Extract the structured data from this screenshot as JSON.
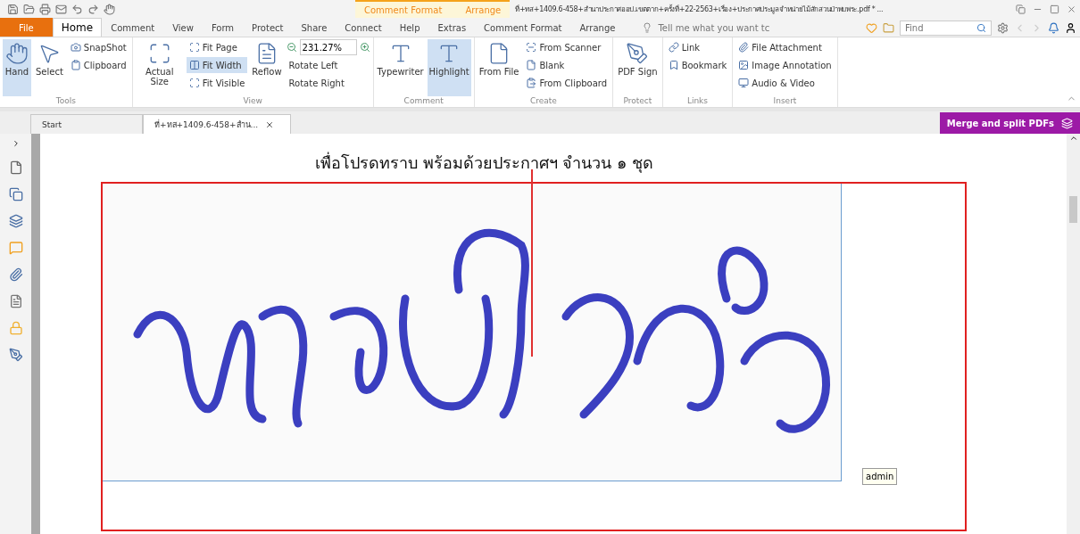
{
  "window": {
    "title": "ที่+ทส+1409.6-458+สำนาประกาศออป.เขตตาก+ครั้งที่+22-2563+เรื่อง+ประกาศประมูลจำหน่ายไม้สักสวนป่าพบพระ.pdf * ..."
  },
  "context_tabs": [
    "Comment Format",
    "Arrange"
  ],
  "tabs": [
    {
      "label": "File",
      "kind": "file",
      "selected": false
    },
    {
      "label": "Home",
      "kind": "tab",
      "selected": true
    },
    {
      "label": "Comment",
      "kind": "tab",
      "selected": false
    },
    {
      "label": "View",
      "kind": "tab",
      "selected": false
    },
    {
      "label": "Form",
      "kind": "tab",
      "selected": false
    },
    {
      "label": "Protect",
      "kind": "tab",
      "selected": false
    },
    {
      "label": "Share",
      "kind": "tab",
      "selected": false
    },
    {
      "label": "Connect",
      "kind": "tab",
      "selected": false
    },
    {
      "label": "Help",
      "kind": "tab",
      "selected": false
    },
    {
      "label": "Extras",
      "kind": "tab",
      "selected": false
    },
    {
      "label": "Comment Format",
      "kind": "tab",
      "selected": false
    },
    {
      "label": "Arrange",
      "kind": "tab",
      "selected": false
    }
  ],
  "tell_me": {
    "placeholder": "Tell me what you want tc"
  },
  "find": {
    "placeholder": "Find"
  },
  "ribbon": [
    {
      "label": "Tools",
      "columns": [
        [
          {
            "kind": "large",
            "label": "Hand",
            "selected": true
          }
        ],
        [
          {
            "kind": "large",
            "label": "Select",
            "selected": false
          }
        ],
        [
          {
            "kind": "small",
            "label": "SnapShot",
            "selected": false
          },
          {
            "kind": "small",
            "label": "Clipboard",
            "selected": false
          }
        ]
      ]
    },
    {
      "label": "View",
      "columns": [
        [
          {
            "kind": "large",
            "label": "Actual Size",
            "selected": false
          }
        ],
        [
          {
            "kind": "small",
            "label": "Fit Page",
            "selected": false
          },
          {
            "kind": "small",
            "label": "Fit Width",
            "selected": true
          },
          {
            "kind": "small",
            "label": "Fit Visible",
            "selected": false
          }
        ],
        [
          {
            "kind": "large",
            "label": "Reflow",
            "selected": false
          }
        ],
        [
          {
            "kind": "zoom",
            "label": "231.27%",
            "selected": false
          },
          {
            "kind": "small",
            "label": "Rotate Left",
            "selected": false
          },
          {
            "kind": "small",
            "label": "Rotate Right",
            "selected": false
          }
        ]
      ]
    },
    {
      "label": "Comment",
      "columns": [
        [
          {
            "kind": "large",
            "label": "Typewriter",
            "selected": false
          }
        ],
        [
          {
            "kind": "large",
            "label": "Highlight",
            "selected": true
          }
        ]
      ]
    },
    {
      "label": "Create",
      "columns": [
        [
          {
            "kind": "large",
            "label": "From File",
            "selected": false
          }
        ],
        [
          {
            "kind": "small",
            "label": "From Scanner",
            "selected": false
          },
          {
            "kind": "small",
            "label": "Blank",
            "selected": false
          },
          {
            "kind": "small",
            "label": "From Clipboard",
            "selected": false
          }
        ]
      ]
    },
    {
      "label": "Protect",
      "columns": [
        [
          {
            "kind": "large",
            "label": "PDF Sign",
            "selected": false
          }
        ]
      ]
    },
    {
      "label": "Links",
      "columns": [
        [
          {
            "kind": "small",
            "label": "Link",
            "selected": false
          },
          {
            "kind": "small",
            "label": "Bookmark",
            "selected": false
          }
        ]
      ]
    },
    {
      "label": "Insert",
      "columns": [
        [
          {
            "kind": "small",
            "label": "File Attachment",
            "selected": false
          },
          {
            "kind": "small",
            "label": "Image Annotation",
            "selected": false
          },
          {
            "kind": "small",
            "label": "Audio & Video",
            "selected": false
          }
        ]
      ]
    }
  ],
  "doc_tabs": [
    {
      "label": "Start",
      "selected": false
    },
    {
      "label": "ที่+ทส+1409.6-458+สำน...",
      "selected": true
    }
  ],
  "merge_button": "Merge and split PDFs",
  "document": {
    "line": "เพื่อโปรดทราบ พร้อมด้วยประกาศฯ จำนวน ๑ ชุด",
    "signature": {
      "kind": "picture",
      "selected": true
    },
    "tooltip": "admin"
  }
}
